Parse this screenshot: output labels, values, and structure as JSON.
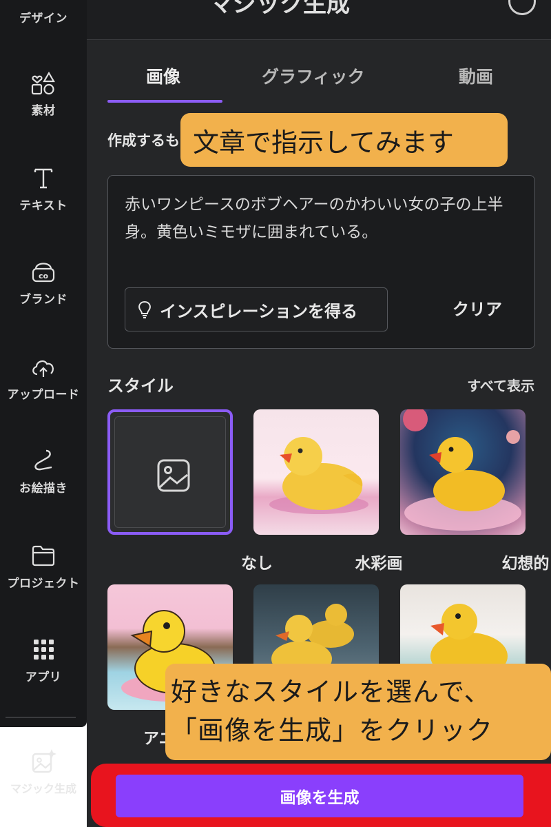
{
  "sidebar": {
    "items": [
      {
        "label": "デザイン",
        "icon": "design-icon"
      },
      {
        "label": "素材",
        "icon": "elements-icon"
      },
      {
        "label": "テキスト",
        "icon": "text-icon"
      },
      {
        "label": "ブランド",
        "icon": "brand-icon"
      },
      {
        "label": "アップロード",
        "icon": "upload-cloud-icon"
      },
      {
        "label": "お絵描き",
        "icon": "draw-icon"
      },
      {
        "label": "プロジェクト",
        "icon": "folder-icon"
      },
      {
        "label": "アプリ",
        "icon": "apps-grid-icon"
      }
    ],
    "magic": {
      "label": "マジック生成",
      "icon": "magic-image-icon"
    }
  },
  "panel": {
    "title": "マジック生成",
    "tabs": [
      {
        "label": "画像",
        "active": true
      },
      {
        "label": "グラフィック",
        "active": false
      },
      {
        "label": "動画",
        "active": false
      }
    ],
    "prompt_section_label": "作成するものを説明",
    "prompt_text": "赤いワンピースのボブヘアーのかわいい女の子の上半身。黄色いミモザに囲まれている。",
    "inspiration_button": "インスピレーションを得る",
    "clear_button": "クリア",
    "style_heading": "スタイル",
    "show_all": "すべて表示",
    "styles": [
      {
        "name": "なし",
        "selected": true
      },
      {
        "name": "水彩画",
        "selected": false
      },
      {
        "name": "幻想的",
        "selected": false
      },
      {
        "name": "アニメ",
        "selected": false
      },
      {
        "name": "",
        "selected": false
      },
      {
        "name": "",
        "selected": false
      }
    ],
    "generate_button": "画像を生成"
  },
  "callouts": {
    "top": "文章で指示してみます",
    "bottom_line1": "好きなスタイルを選んで、",
    "bottom_line2": "「画像を生成」をクリック"
  },
  "colors": {
    "accent": "#8b5cf6",
    "generate": "#8a3ffc",
    "callout": "#f2b14c",
    "highlight_border": "#e8141e"
  }
}
